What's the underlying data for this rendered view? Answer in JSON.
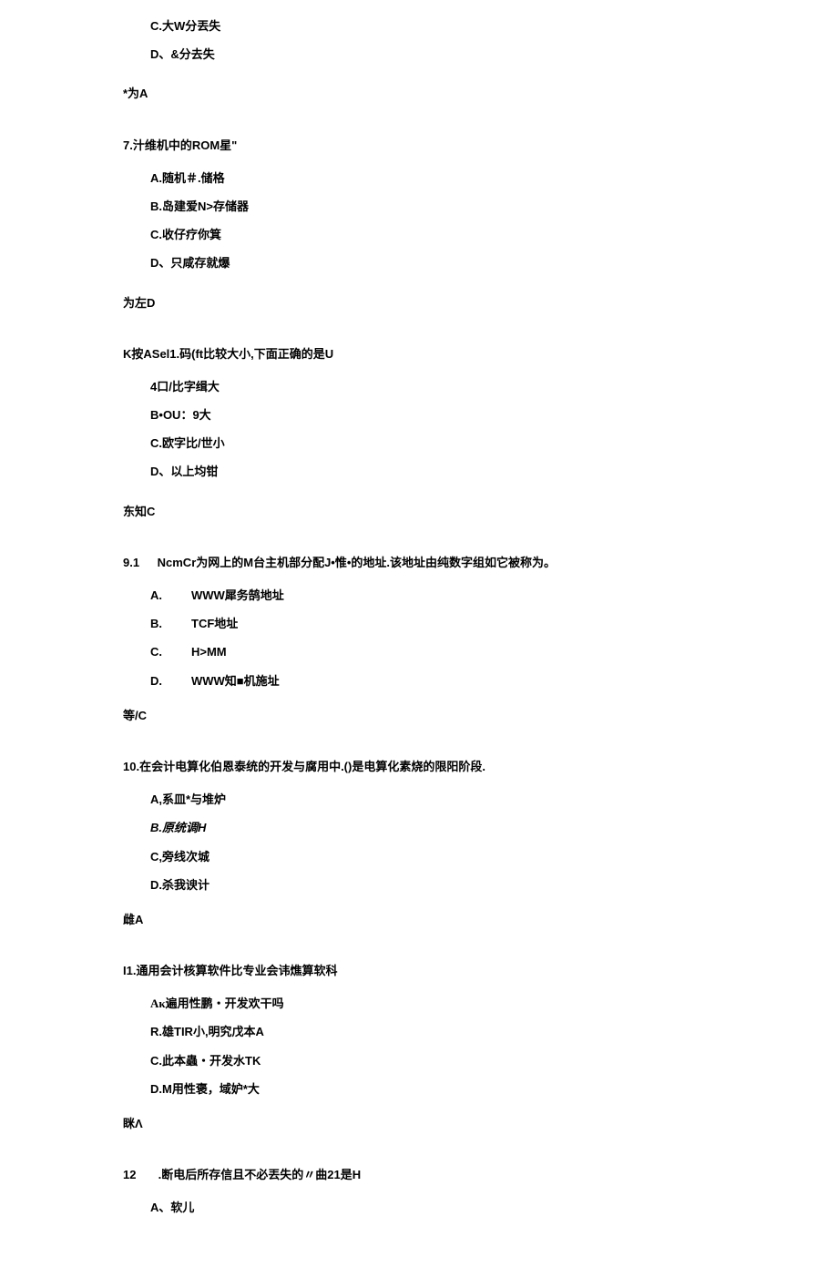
{
  "q6_tail": {
    "optC": "C.大W分丟失",
    "optD": "D、&分去失",
    "answer": "*为A"
  },
  "q7": {
    "question": "7.汁维机中的ROM星\"",
    "optA": "A.随机＃.储格",
    "optB": "B.岛建爱N>存储器",
    "optC": "C.收仔疗你箕",
    "optD": "D、只咸存就爆",
    "answer": "为左D"
  },
  "q8": {
    "question": "K按ASel1.码(ft比较大小,下面正确的是U",
    "optA": "4口/比字缉大",
    "optB": "B•OU：9大",
    "optC": "C.欧字比/世小",
    "optD": "D、以上均钳",
    "answer": "东知C"
  },
  "q91": {
    "num": "9.1",
    "question": "NcmCr为网上的M台主机部分配J•惟•的地址.该地址由纯数字组如它被称为。",
    "optA_letter": "A.",
    "optA_text": "WWW犀务鹄地址",
    "optB_letter": "B.",
    "optB_text": "TCF地址",
    "optC_letter": "C.",
    "optC_text": "H>MM",
    "optD_letter": "D.",
    "optD_text": "WWW知■机施址",
    "answer": "等/C"
  },
  "q10": {
    "question": "10.在会计电算化伯恩泰统的开发与腐用中.()是电算化素烧的限阳阶段.",
    "optA": "A,系皿*与堆炉",
    "optB": "B.原统调H",
    "optC": "C,旁线次城",
    "optD": "D.杀我谀计",
    "answer": "雌A"
  },
  "q11": {
    "question": "I1.通用会计核算软件比专业会讳燋算软科",
    "optA": "Aκ遍用性鹏・开发欢干吗",
    "optB": "R.雄TIR小,明究戊本A",
    "optC": "C.此本蟲・开发水TK",
    "optD": "D.M用性褒，域妒*大",
    "answer": "眯Λ"
  },
  "q12": {
    "num": "12",
    "question": ".断电后所存信且不必丟失的〃曲21是H",
    "optA": "A、软儿"
  }
}
